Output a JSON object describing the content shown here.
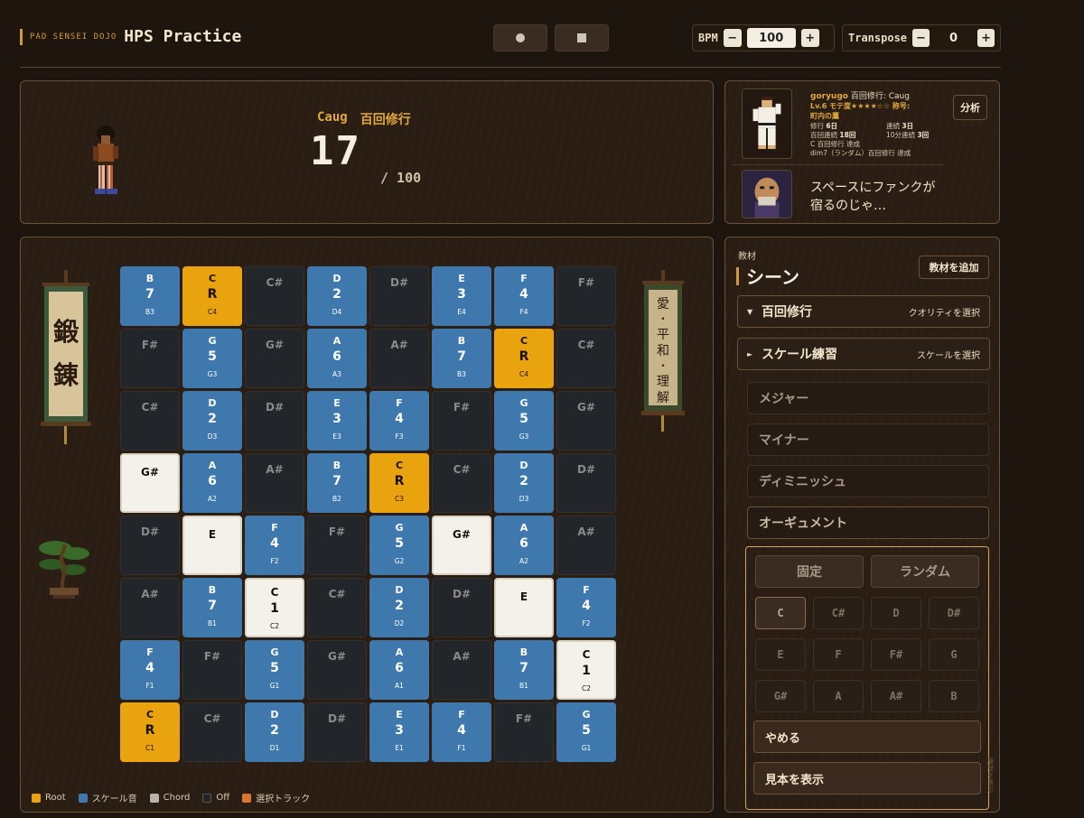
{
  "header": {
    "brand_sub": "PAD SENSEI DOJO",
    "brand_title": "HPS Practice",
    "bpm_label": "BPM",
    "bpm_value": "100",
    "transpose_label": "Transpose",
    "transpose_value": "0",
    "minus": "−",
    "plus": "+"
  },
  "status": {
    "chord": "Caug",
    "mode": "百回修行",
    "count": "17",
    "total": "/ 100"
  },
  "profile": {
    "user": "goryugo",
    "activity": "百回修行: Caug",
    "level": "Lv.6 モテ度★★★★☆☆ 称号:",
    "title": "町内の鷹",
    "stats": [
      {
        "label": "修行",
        "value": "6日",
        "label2": "連続",
        "value2": "3日"
      },
      {
        "label": "百回連続",
        "value": "18回",
        "label2": "10分連続",
        "value2": "3回"
      }
    ],
    "achievements": [
      "C 百回修行 達成",
      "dim7（ランダム）百回修行 達成"
    ],
    "analyze": "分析",
    "sensei_line1": "スペースにファンクが",
    "sensei_line2": "宿るのじゃ…"
  },
  "scrolls": {
    "left": [
      "鍛",
      "錬"
    ],
    "right": [
      "愛",
      "・",
      "平",
      "和",
      "・",
      "理",
      "解"
    ]
  },
  "pads": [
    [
      [
        "scale",
        "B",
        "7",
        "B3"
      ],
      [
        "root",
        "C",
        "R",
        "C4"
      ],
      [
        "off",
        "C#"
      ],
      [
        "scale",
        "D",
        "2",
        "D4"
      ],
      [
        "off",
        "D#"
      ],
      [
        "scale",
        "E",
        "3",
        "E4"
      ],
      [
        "scale",
        "F",
        "4",
        "F4"
      ],
      [
        "off",
        "F#"
      ]
    ],
    [
      [
        "off",
        "F#"
      ],
      [
        "scale",
        "G",
        "5",
        "G3"
      ],
      [
        "off",
        "G#"
      ],
      [
        "scale",
        "A",
        "6",
        "A3"
      ],
      [
        "off",
        "A#"
      ],
      [
        "scale",
        "B",
        "7",
        "B3"
      ],
      [
        "root",
        "C",
        "R",
        "C4"
      ],
      [
        "off",
        "C#"
      ]
    ],
    [
      [
        "off",
        "C#"
      ],
      [
        "scale",
        "D",
        "2",
        "D3"
      ],
      [
        "off",
        "D#"
      ],
      [
        "scale",
        "E",
        "3",
        "E3"
      ],
      [
        "scale",
        "F",
        "4",
        "F3"
      ],
      [
        "off",
        "F#"
      ],
      [
        "scale",
        "G",
        "5",
        "G3"
      ],
      [
        "off",
        "G#"
      ]
    ],
    [
      [
        "chord",
        "G#"
      ],
      [
        "scale",
        "A",
        "6",
        "A2"
      ],
      [
        "off",
        "A#"
      ],
      [
        "scale",
        "B",
        "7",
        "B2"
      ],
      [
        "root",
        "C",
        "R",
        "C3"
      ],
      [
        "off",
        "C#"
      ],
      [
        "scale",
        "D",
        "2",
        "D3"
      ],
      [
        "off",
        "D#"
      ]
    ],
    [
      [
        "off",
        "D#"
      ],
      [
        "chord",
        "E"
      ],
      [
        "scale",
        "F",
        "4",
        "F2"
      ],
      [
        "off",
        "F#"
      ],
      [
        "scale",
        "G",
        "5",
        "G2"
      ],
      [
        "chord",
        "G#"
      ],
      [
        "scale",
        "A",
        "6",
        "A2"
      ],
      [
        "off",
        "A#"
      ]
    ],
    [
      [
        "off",
        "A#"
      ],
      [
        "scale",
        "B",
        "7",
        "B1"
      ],
      [
        "chord",
        "C",
        "1",
        "C2"
      ],
      [
        "off",
        "C#"
      ],
      [
        "scale",
        "D",
        "2",
        "D2"
      ],
      [
        "off",
        "D#"
      ],
      [
        "chord",
        "E"
      ],
      [
        "scale",
        "F",
        "4",
        "F2"
      ]
    ],
    [
      [
        "scale",
        "F",
        "4",
        "F1"
      ],
      [
        "off",
        "F#"
      ],
      [
        "scale",
        "G",
        "5",
        "G1"
      ],
      [
        "off",
        "G#"
      ],
      [
        "scale",
        "A",
        "6",
        "A1"
      ],
      [
        "off",
        "A#"
      ],
      [
        "scale",
        "B",
        "7",
        "B1"
      ],
      [
        "chord",
        "C",
        "1",
        "C2"
      ]
    ],
    [
      [
        "root",
        "C",
        "R",
        "C1"
      ],
      [
        "off",
        "C#"
      ],
      [
        "scale",
        "D",
        "2",
        "D1"
      ],
      [
        "off",
        "D#"
      ],
      [
        "scale",
        "E",
        "3",
        "E1"
      ],
      [
        "scale",
        "F",
        "4",
        "F1"
      ],
      [
        "off",
        "F#"
      ],
      [
        "scale",
        "G",
        "5",
        "G1"
      ]
    ]
  ],
  "legend": [
    {
      "label": "Root",
      "color": "#e8a30e"
    },
    {
      "label": "スケール音",
      "color": "#3f78ad"
    },
    {
      "label": "Chord",
      "color": "#b8b4ac"
    },
    {
      "label": "Off",
      "color": "#22262a"
    },
    {
      "label": "選択トラック",
      "color": "#d9772e"
    }
  ],
  "sidebar": {
    "sub": "教材",
    "title": "シーン",
    "add": "教材を追加",
    "sections": [
      {
        "label": "百回修行",
        "hint": "クオリティを選択",
        "chev": "▼"
      },
      {
        "label": "スケール練習",
        "hint": "スケールを選択",
        "chev": "►"
      }
    ],
    "qualities": [
      "メジャー",
      "マイナー",
      "ディミニッシュ",
      "オーギュメント"
    ],
    "mode_fixed": "固定",
    "mode_random": "ランダム",
    "keys": [
      "C",
      "C#",
      "D",
      "D#",
      "E",
      "F",
      "F#",
      "G",
      "G#",
      "A",
      "A#",
      "B"
    ],
    "stop": "やめる",
    "show_example": "見本を表示",
    "vertical_note": "履歴を表示"
  }
}
